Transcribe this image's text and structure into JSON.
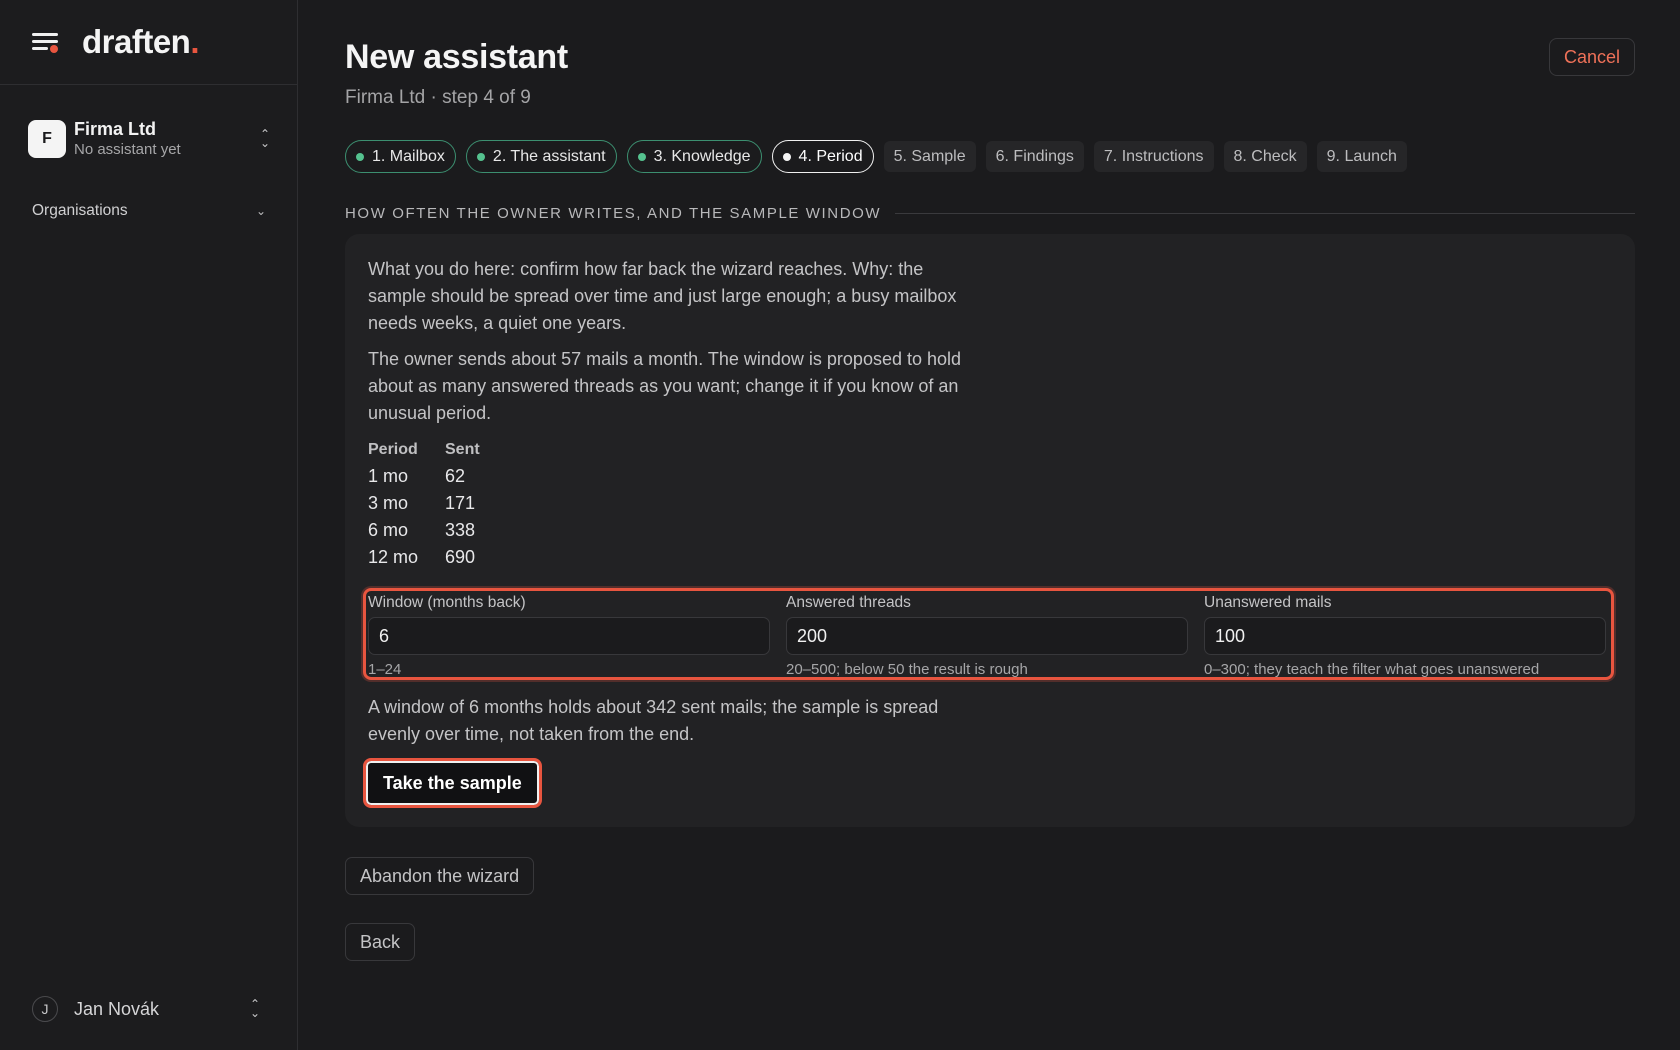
{
  "brand": {
    "name": "draften",
    "dot": "."
  },
  "sidebar": {
    "org": {
      "initial": "F",
      "name": "Firma Ltd",
      "subtitle": "No assistant yet"
    },
    "organisations_label": "Organisations",
    "user": {
      "initial": "J",
      "name": "Jan Novák"
    }
  },
  "header": {
    "title": "New assistant",
    "subtitle": "Firma Ltd · step 4 of 9",
    "cancel_label": "Cancel"
  },
  "steps": [
    {
      "label": "1. Mailbox",
      "state": "done"
    },
    {
      "label": "2. The assistant",
      "state": "done"
    },
    {
      "label": "3. Knowledge",
      "state": "done"
    },
    {
      "label": "4. Period",
      "state": "current"
    },
    {
      "label": "5. Sample",
      "state": "todo"
    },
    {
      "label": "6. Findings",
      "state": "todo"
    },
    {
      "label": "7. Instructions",
      "state": "todo"
    },
    {
      "label": "8. Check",
      "state": "todo"
    },
    {
      "label": "9. Launch",
      "state": "todo"
    }
  ],
  "section": {
    "title": "HOW OFTEN THE OWNER WRITES, AND THE SAMPLE WINDOW",
    "intro": "What you do here: confirm how far back the wizard reaches. Why: the sample should be spread over time and just large enough; a busy mailbox needs weeks, a quiet one years.",
    "explanation": "The owner sends about 57 mails a month. The window is proposed to hold about as many answered threads as you want; change it if you know of an unusual period.",
    "table": {
      "headers": [
        "Period",
        "Sent"
      ],
      "rows": [
        [
          "1 mo",
          "62"
        ],
        [
          "3 mo",
          "171"
        ],
        [
          "6 mo",
          "338"
        ],
        [
          "12 mo",
          "690"
        ]
      ]
    },
    "fields": [
      {
        "label": "Window (months back)",
        "value": "6",
        "hint": "1–24"
      },
      {
        "label": "Answered threads",
        "value": "200",
        "hint": "20–500; below 50 the result is rough"
      },
      {
        "label": "Unanswered mails",
        "value": "100",
        "hint": "0–300; they teach the filter what goes unanswered"
      }
    ],
    "summary": "A window of 6 months holds about 342 sent mails; the sample is spread evenly over time, not taken from the end.",
    "take_sample_label": "Take the sample"
  },
  "actions": {
    "abandon_label": "Abandon the wizard",
    "back_label": "Back"
  },
  "colors": {
    "accent": "#e8553f",
    "done_green": "#55c28f",
    "background": "#1b1b1d",
    "panel": "#222224"
  }
}
